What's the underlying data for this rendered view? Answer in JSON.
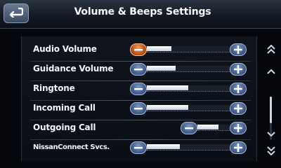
{
  "header": {
    "title": "Volume & Beeps Settings",
    "back_icon": "back-arrow-icon"
  },
  "settings": [
    {
      "label": "Audio Volume",
      "level": 0.3,
      "minus_active": true
    },
    {
      "label": "Guidance Volume",
      "level": 0.35,
      "minus_active": false
    },
    {
      "label": "Ringtone",
      "level": 0.5,
      "minus_active": false
    },
    {
      "label": "Incoming Call",
      "level": 0.5,
      "minus_active": false
    },
    {
      "label": "Outgoing Call",
      "level": 0.65,
      "minus_active": false
    },
    {
      "label": "NissanConnect Svcs.",
      "level": 0.4,
      "minus_active": false
    }
  ],
  "scroll": {
    "page_up_icon": "double-chevron-up-icon",
    "line_up_icon": "chevron-up-icon",
    "line_down_icon": "chevron-down-icon",
    "page_down_icon": "double-chevron-down-icon",
    "position": 0.0
  },
  "colors": {
    "accent_blue": "#3a5585",
    "active_orange": "#b04714"
  }
}
